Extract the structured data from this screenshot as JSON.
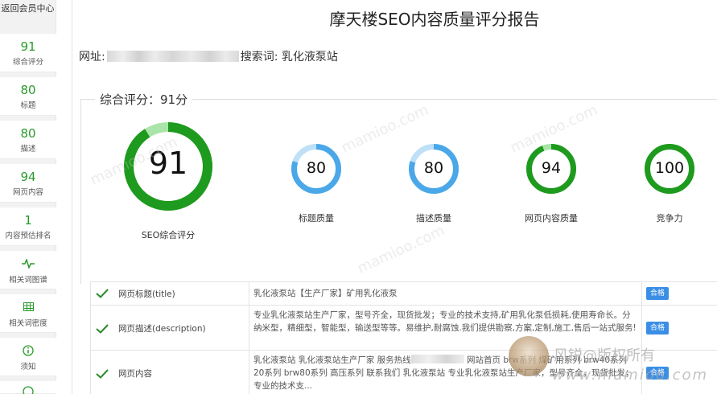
{
  "sidebar": {
    "back_label": "返回会员中心",
    "items": [
      {
        "value": "91",
        "label": "综合评分"
      },
      {
        "value": "80",
        "label": "标题"
      },
      {
        "value": "80",
        "label": "描述"
      },
      {
        "value": "94",
        "label": "网页内容"
      },
      {
        "value": "1",
        "label": "内容预估排名"
      },
      {
        "icon": "pulse-icon",
        "label": "相关词图谱"
      },
      {
        "icon": "grid-icon",
        "label": "相关词密度"
      },
      {
        "icon": "info-icon",
        "label": "须知"
      }
    ]
  },
  "header": {
    "title": "摩天楼SEO内容质量评分报告",
    "url_label": "网址:",
    "keyword_label": "搜索词:",
    "keyword": "乳化液泵站"
  },
  "overall": {
    "legend": "综合评分：91分"
  },
  "scores": [
    {
      "value": "91",
      "label": "SEO综合评分",
      "percent": 91,
      "color": "#1e9a1e",
      "track": "#a9e5a9"
    },
    {
      "value": "80",
      "label": "标题质量",
      "percent": 80,
      "color": "#4aa8e8",
      "track": "#bfe0f7"
    },
    {
      "value": "80",
      "label": "描述质量",
      "percent": 80,
      "color": "#4aa8e8",
      "track": "#bfe0f7"
    },
    {
      "value": "94",
      "label": "网页内容质量",
      "percent": 94,
      "color": "#1e9a1e",
      "track": "#a9e5a9"
    },
    {
      "value": "100",
      "label": "竞争力",
      "percent": 100,
      "color": "#1e9a1e",
      "track": "#a9e5a9"
    }
  ],
  "details": [
    {
      "name": "网页标题(title)",
      "text": "乳化液泵站【生产厂家】矿用乳化液泵",
      "badge": "合格"
    },
    {
      "name": "网页描述(description)",
      "text": "专业乳化液泵站生产厂家，型号齐全，现货批发；专业的技术支持,矿用乳化泵低损耗,使用寿命长。分纳米型，精细型，智能型，输送型等等。易维护,耐腐蚀.我们提供勘察,方案,定制,施工,售后一站式服务!",
      "badge": "合格"
    },
    {
      "name": "网页内容",
      "text_a": "乳化液泵站 乳化液泵站生产厂家 服务热线",
      "text_b": "网站首页 brw系列 煤矿用系列 brw40系列 20系列 brw80系列 高压系列 联系我们 乳化液泵站 专业乳化液泵站生产厂家，型号齐全，现货批发；专业的技术支...",
      "badge": "合格"
    }
  ],
  "watermark": {
    "brand": "风锐@版权所有",
    "url": "www.mamioo.com",
    "faint": "mamioo.com"
  }
}
